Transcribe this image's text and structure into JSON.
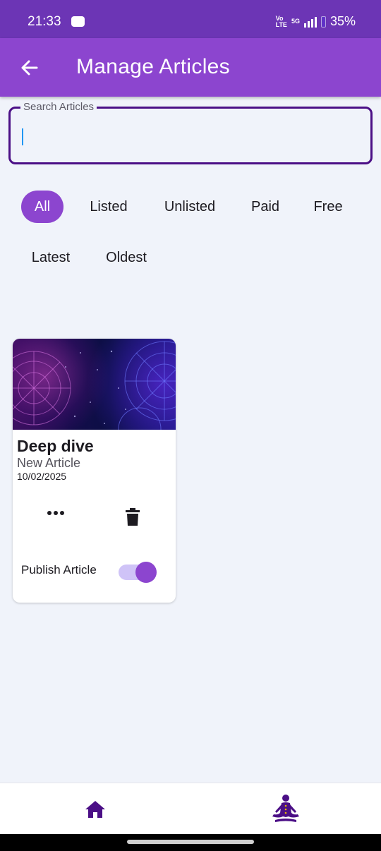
{
  "status_bar": {
    "time": "21:33",
    "network_label": "Vo\nLTE",
    "network_type": "5G",
    "battery": "35%"
  },
  "app_bar": {
    "title": "Manage Articles",
    "back_icon": "arrow-left-icon"
  },
  "search": {
    "label": "Search Articles",
    "value": "",
    "placeholder": ""
  },
  "filters": {
    "selected": "All",
    "items": [
      "All",
      "Listed",
      "Unlisted",
      "Paid",
      "Free",
      "Latest",
      "Oldest"
    ]
  },
  "articles": [
    {
      "title": "Deep dive",
      "subtitle": "New Article",
      "date": "10/02/2025",
      "image": "zodiac-night-sky-banner",
      "more_icon": "more-horizontal-icon",
      "delete_icon": "trash-icon",
      "publish_label": "Publish Article",
      "published": true
    }
  ],
  "bottom_nav": {
    "items": [
      {
        "icon": "home-icon"
      },
      {
        "icon": "meditation-icon"
      }
    ]
  },
  "colors": {
    "status_bar": "#6c35b5",
    "app_bar": "#8c45cf",
    "accent": "#8c45cf",
    "search_border": "#4b0f86",
    "background": "#f0f3fa",
    "nav_icon": "#4b0f86",
    "toggle_track": "#cfc3f7"
  }
}
